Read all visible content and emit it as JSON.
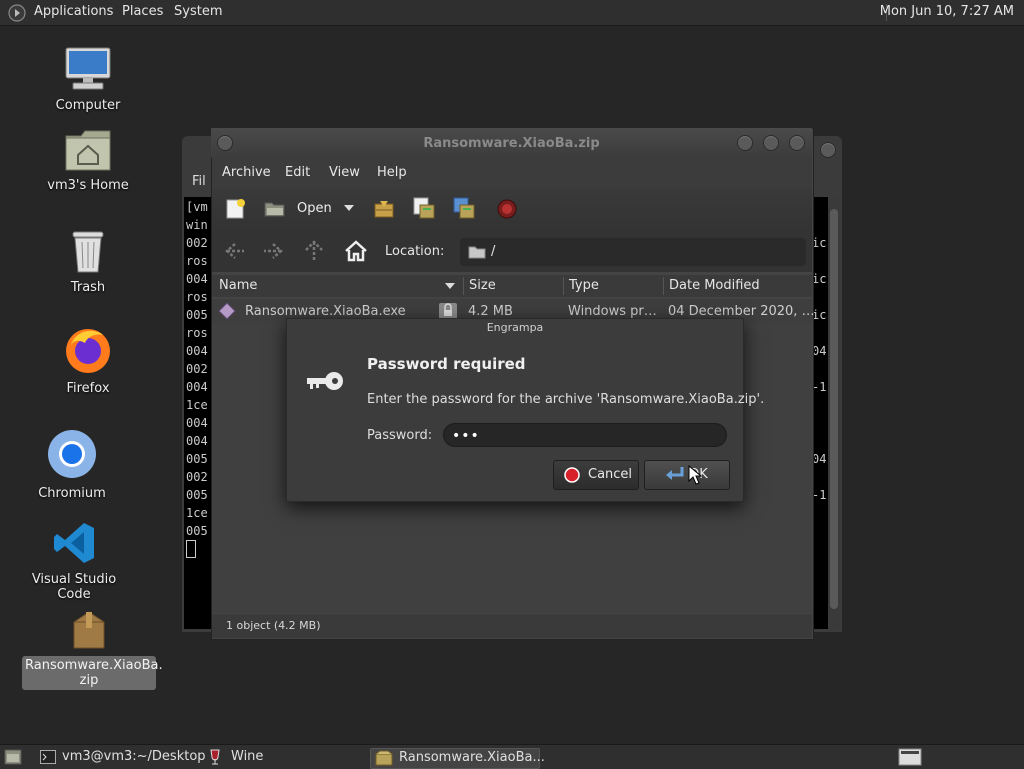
{
  "top_panel": {
    "menus": [
      "Applications",
      "Places",
      "System"
    ],
    "clock": "Mon Jun 10,  7:27 AM"
  },
  "desktop": {
    "icons": [
      {
        "label": "Computer",
        "icon": "computer-icon"
      },
      {
        "label": "vm3's Home",
        "icon": "home-folder-icon"
      },
      {
        "label": "Trash",
        "icon": "trash-icon"
      },
      {
        "label": "Firefox",
        "icon": "firefox-icon"
      },
      {
        "label": "Chromium",
        "icon": "chromium-icon"
      },
      {
        "label": "Visual Studio Code",
        "icon": "vscode-icon"
      },
      {
        "label": "Ransomware.XiaoBa.\nzip",
        "icon": "archive-icon",
        "selected": true
      }
    ]
  },
  "terminal": {
    "menu_partial": "Fil",
    "lines": [
      "[vm",
      "win",
      "002",
      "ros",
      "004",
      "ros",
      "005",
      "ros",
      "004",
      "002",
      "004",
      "1ce",
      "004",
      "004",
      "005",
      "002",
      "005",
      "1ce",
      "005"
    ],
    "right_fragments": [
      "ic",
      "ic",
      "ic",
      "04",
      "-1",
      "04",
      "-1"
    ]
  },
  "archive_window": {
    "title": "Ransomware.XiaoBa.zip",
    "menu": [
      "Archive",
      "Edit",
      "View",
      "Help"
    ],
    "toolbar": {
      "open_label": "Open"
    },
    "location": {
      "label": "Location:",
      "path": "/"
    },
    "columns": [
      "Name",
      "Size",
      "Type",
      "Date Modified"
    ],
    "file": {
      "name": "Ransomware.XiaoBa.exe",
      "size": "4.2 MB",
      "type": "Windows pr…",
      "date": "04 December 2020, …"
    },
    "status": "1 object (4.2 MB)"
  },
  "dialog": {
    "title": "Engrampa",
    "heading": "Password required",
    "message": "Enter the password for the archive 'Ransomware.XiaoBa.zip'.",
    "password_label": "Password:",
    "password_value": "•••",
    "cancel_label": "Cancel",
    "ok_label": "OK"
  },
  "taskbar": {
    "items": [
      {
        "label": "vm3@vm3:~/Desktop",
        "icon": "terminal-icon"
      },
      {
        "label": "Wine",
        "icon": "wine-icon"
      },
      {
        "label": "Ransomware.XiaoBa...",
        "icon": "archive-manager-icon",
        "active": true
      }
    ]
  },
  "colors": {
    "panel_bg": "#2f2f2f",
    "desktop_bg": "#262626",
    "cancel_red": "#d8202a",
    "ok_arrow_blue": "#6aa0d8"
  }
}
